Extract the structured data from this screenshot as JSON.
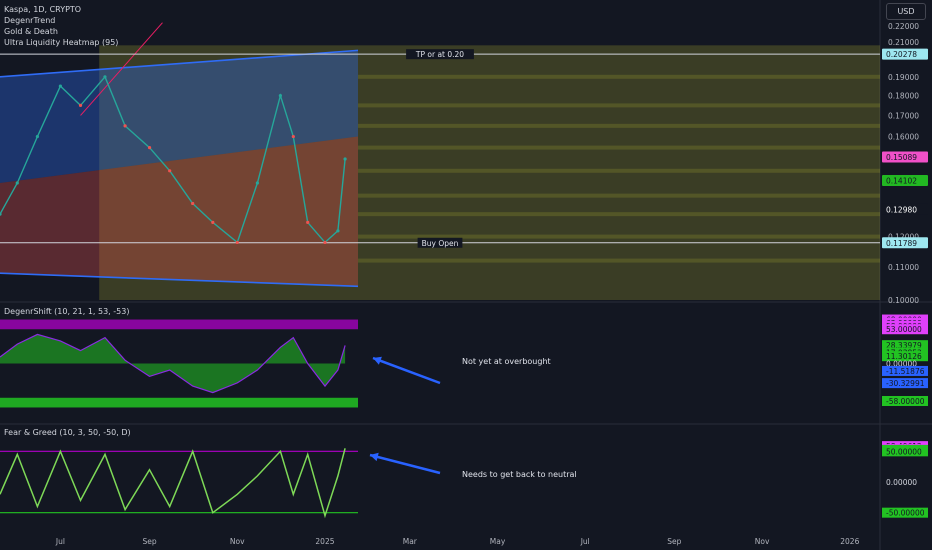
{
  "legend": {
    "symbol": "Kaspa, 1D, CRYPTO",
    "indicators": [
      "DegenrTrend",
      "Gold & Death",
      "Ultra Liquidity Heatmap (95)"
    ]
  },
  "currency": "USD",
  "panes": {
    "degenr_shift_title": "DegenrShift (10, 21, 1, 53, -53)",
    "fear_greed_title": "Fear & Greed (10, 3, 50, -50, D)"
  },
  "annotations": {
    "overbought": "Not yet at overbought",
    "neutral": "Needs to get back to neutral"
  },
  "colors": {
    "background": "#131722",
    "bull": "#26a69a",
    "bear": "#ef5350",
    "purple": "#b000c8",
    "green": "#22c322",
    "yellow_zone": "#c8c832",
    "channel_blue": "#2f6cf6",
    "arrow_blue": "#2962ff"
  },
  "chart_data": [
    {
      "type": "line",
      "pane": "price",
      "y_scale": "log",
      "ylim": [
        0.1,
        0.225
      ],
      "y_ticks": [
        "0.22000",
        "0.21000",
        "0.19000",
        "0.18000",
        "0.17000",
        "0.16000",
        "0.13000",
        "0.12000",
        "0.11000",
        "0.10000"
      ],
      "x_ticks": [
        "Jul",
        "Sep",
        "Nov",
        "2025",
        "Mar",
        "May",
        "Jul",
        "Sep",
        "Nov",
        "2026"
      ],
      "price_labels": [
        {
          "value": 0.20278,
          "text": "0.20278",
          "color": "#9ee7f0"
        },
        {
          "value": 0.15089,
          "text": "0.15089",
          "color": "#f050c8"
        },
        {
          "value": 0.14102,
          "text": "0.14102",
          "color": "#22b822"
        },
        {
          "value": 0.1298,
          "text": "0.12980",
          "color": "#131722"
        },
        {
          "value": 0.11789,
          "text": "0.11789",
          "color": "#9ee7f0"
        }
      ],
      "horizontal_lines": [
        {
          "value": 0.20278,
          "label": "TP or at 0.20"
        },
        {
          "value": 0.11789,
          "label": "Buy Open"
        }
      ],
      "series": [
        {
          "name": "",
          "x": [
            "2024-05-20",
            "2024-06-01",
            "2024-06-15",
            "2024-07-01",
            "2024-07-15",
            "2024-08-01",
            "2024-08-15",
            "2024-09-01",
            "2024-09-15",
            "2024-10-01",
            "2024-10-15",
            "2024-11-01",
            "2024-11-15",
            "2024-12-01",
            "2024-12-10",
            "2024-12-20",
            "2025-01-01",
            "2025-01-10",
            "2025-01-15"
          ],
          "y": [
            0.128,
            0.14,
            0.16,
            0.185,
            0.175,
            0.19,
            0.165,
            0.155,
            0.145,
            0.132,
            0.125,
            0.118,
            0.14,
            0.18,
            0.16,
            0.125,
            0.118,
            0.122,
            0.15
          ]
        }
      ]
    },
    {
      "type": "area",
      "pane": "degenr_shift",
      "ylim": [
        -75,
        75
      ],
      "y_ticks": [
        "68.00000",
        "63.00000",
        "58.00000",
        "53.00000",
        "28.33979",
        "17.03853",
        "11.30126",
        "0.00000",
        "-11.51876",
        "-30.32991",
        "-58.00000"
      ],
      "levels": [
        53,
        -53
      ],
      "x": [
        "2024-05-20",
        "2024-06-01",
        "2024-06-15",
        "2024-07-01",
        "2024-07-15",
        "2024-08-01",
        "2024-08-15",
        "2024-09-01",
        "2024-09-15",
        "2024-10-01",
        "2024-10-15",
        "2024-11-01",
        "2024-11-15",
        "2024-12-01",
        "2024-12-10",
        "2024-12-20",
        "2025-01-01",
        "2025-01-10",
        "2025-01-15"
      ],
      "series": [
        {
          "name": "",
          "values": [
            10,
            30,
            45,
            35,
            20,
            40,
            5,
            -20,
            -10,
            -35,
            -45,
            -30,
            -10,
            25,
            40,
            0,
            -35,
            -10,
            28
          ]
        }
      ]
    },
    {
      "type": "line",
      "pane": "fear_greed",
      "ylim": [
        -75,
        75
      ],
      "y_ticks": [
        "58.49612",
        "53.49612",
        "52.32575",
        "50.00000",
        "0.00000",
        "-50.00000"
      ],
      "levels": [
        50,
        -50
      ],
      "x": [
        "2024-05-20",
        "2024-06-01",
        "2024-06-15",
        "2024-07-01",
        "2024-07-15",
        "2024-08-01",
        "2024-08-15",
        "2024-09-01",
        "2024-09-15",
        "2024-10-01",
        "2024-10-15",
        "2024-11-01",
        "2024-11-15",
        "2024-12-01",
        "2024-12-10",
        "2024-12-20",
        "2025-01-01",
        "2025-01-10",
        "2025-01-15"
      ],
      "series": [
        {
          "name": "",
          "values": [
            -20,
            45,
            -40,
            50,
            -30,
            45,
            -45,
            20,
            -40,
            50,
            -50,
            -20,
            10,
            50,
            -20,
            45,
            -55,
            10,
            55
          ]
        }
      ]
    }
  ]
}
